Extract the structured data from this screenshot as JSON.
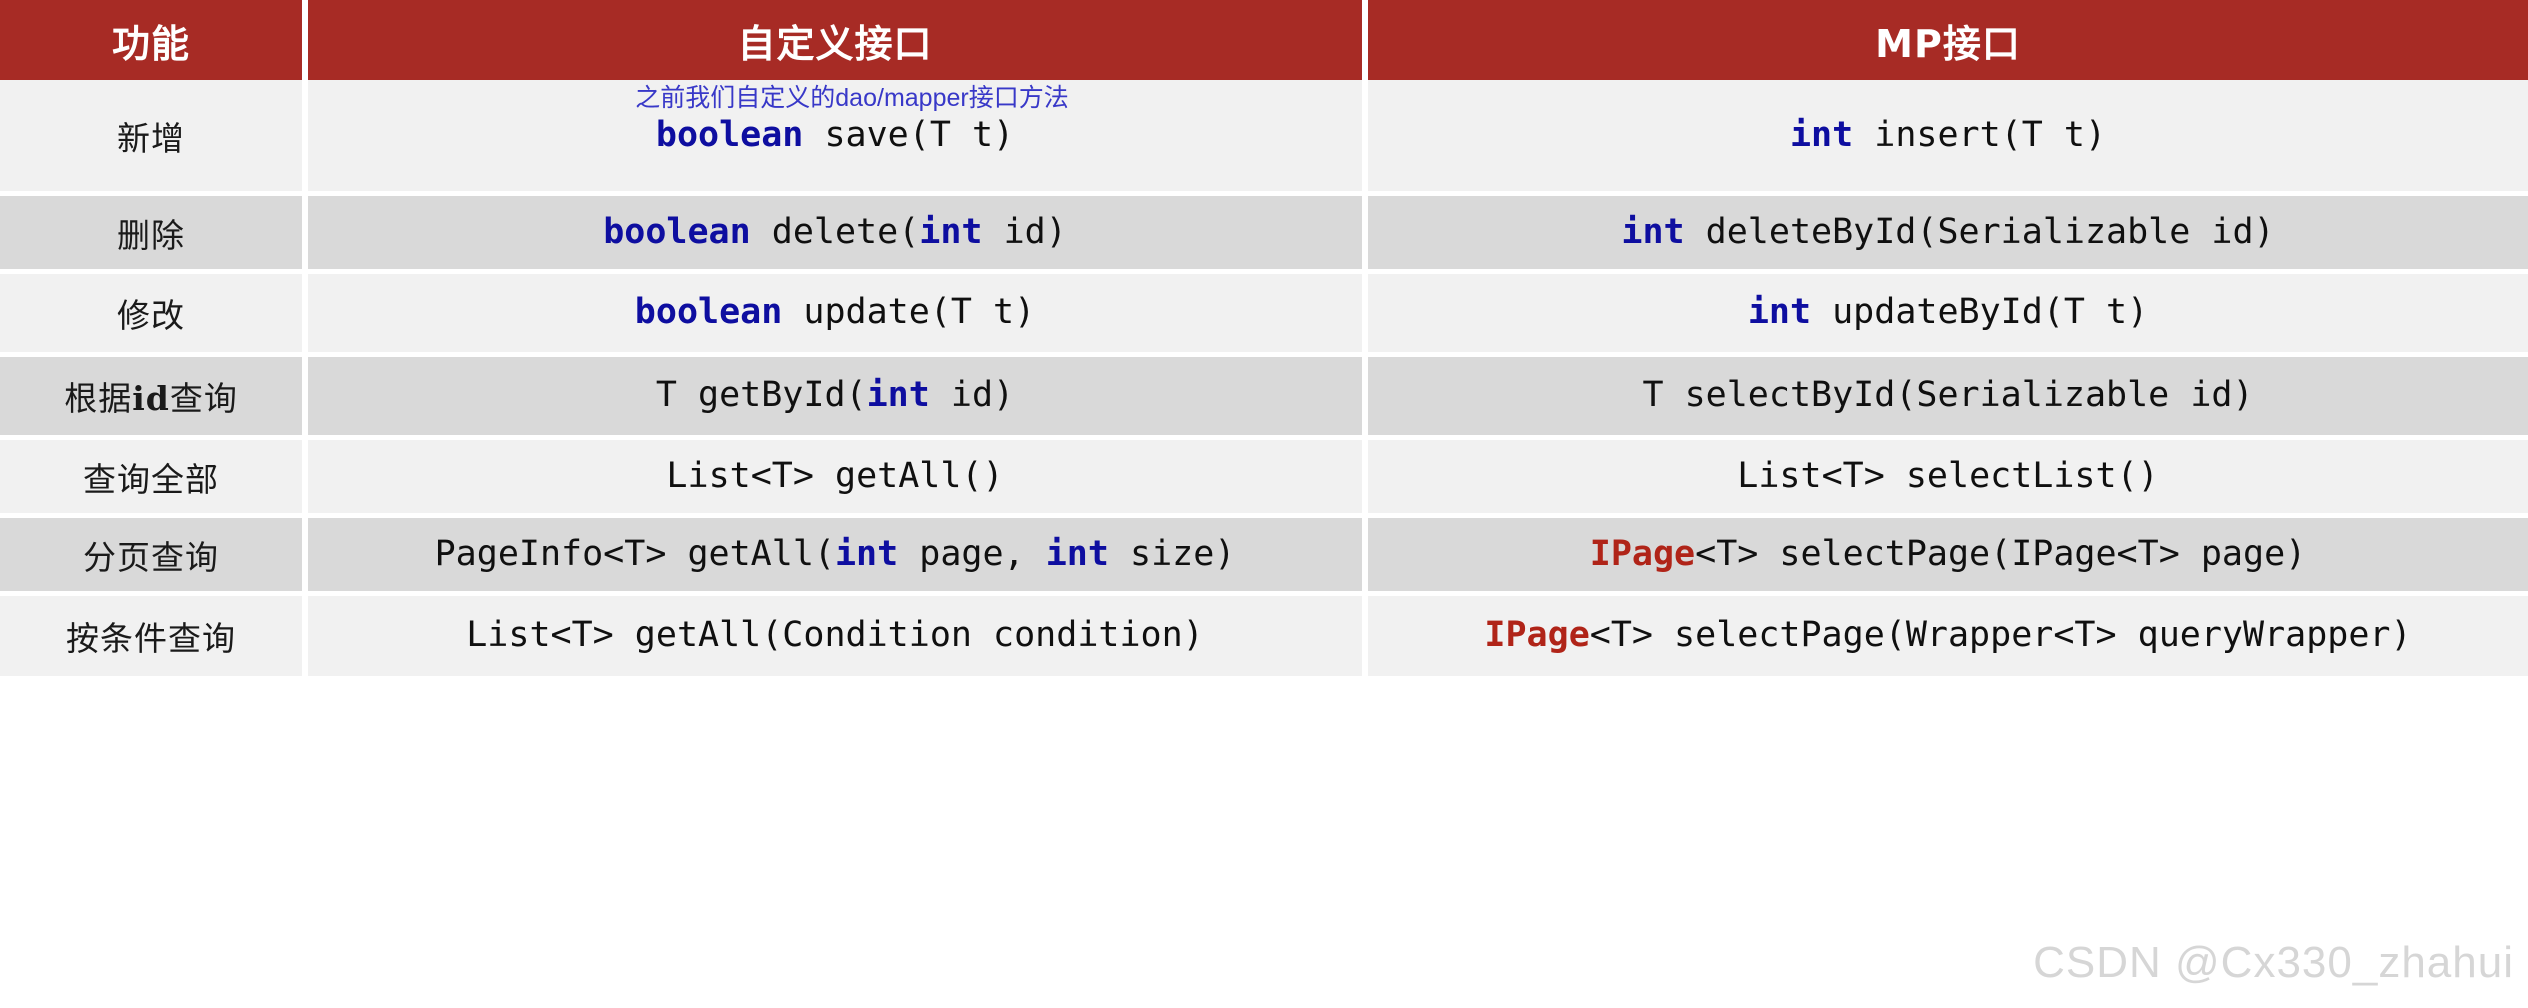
{
  "header": {
    "columns": [
      {
        "label": "功能",
        "key": "feature"
      },
      {
        "label": "自定义接口",
        "key": "custom"
      },
      {
        "label": "MP接口",
        "key": "mp"
      }
    ],
    "background_color": "#A72B25",
    "text_color": "#FFFFFF"
  },
  "annotation": {
    "text": "之前我们自定义的dao/mapper接口方法",
    "color": "#3838C8"
  },
  "colors": {
    "header_red": "#A72B25",
    "row_light": "#F1F1F1",
    "row_dark": "#D9D9D9",
    "keyword_blue": "#0E0EA0",
    "keyword_red": "#B02418",
    "watermark_gray": "#787878"
  },
  "rows": [
    {
      "feature": "新增",
      "feature_html": "新增",
      "custom_html": "<span class=\"kw\">boolean</span> save(T t)",
      "custom_text": "boolean save(T t)",
      "mp_html": "<span class=\"kw\">int</span> insert(T t)",
      "mp_text": "int insert(T t)"
    },
    {
      "feature": "删除",
      "feature_html": "删除",
      "custom_html": "<span class=\"kw\">boolean</span> delete(<span class=\"kw\">int</span> id)",
      "custom_text": "boolean delete(int id)",
      "mp_html": "<span class=\"kw\">int</span> deleteById(Serializable id)",
      "mp_text": "int deleteById(Serializable id)"
    },
    {
      "feature": "修改",
      "feature_html": "修改",
      "custom_html": "<span class=\"kw\">boolean</span> update(T t)",
      "custom_text": "boolean update(T t)",
      "mp_html": "<span class=\"kw\">int</span> updateById(T t)",
      "mp_text": "int updateById(T t)"
    },
    {
      "feature": "根据id查询",
      "feature_html": "根据<b>id</b>查询",
      "custom_html": "T getById(<span class=\"kw\">int</span> id)",
      "custom_text": "T getById(int id)",
      "mp_html": "T selectById(Serializable id)",
      "mp_text": "T selectById(Serializable id)"
    },
    {
      "feature": "查询全部",
      "feature_html": "查询全部",
      "custom_html": "List&lt;T&gt; getAll()",
      "custom_text": "List<T> getAll()",
      "mp_html": "List&lt;T&gt; selectList()",
      "mp_text": "List<T> selectList()"
    },
    {
      "feature": "分页查询",
      "feature_html": "分页查询",
      "custom_html": "PageInfo&lt;T&gt; getAll(<span class=\"kw\">int</span> page, <span class=\"kw\">int</span> size)",
      "custom_text": "PageInfo<T> getAll(int page, int size)",
      "mp_html": "<span class=\"kw-red\">IPage</span>&lt;T&gt; selectPage(IPage&lt;T&gt; page)",
      "mp_text": "IPage<T> selectPage(IPage<T> page)"
    },
    {
      "feature": "按条件查询",
      "feature_html": "按条件查询",
      "custom_html": "List&lt;T&gt; getAll(Condition condition)",
      "custom_text": "List<T> getAll(Condition condition)",
      "mp_html": "<span class=\"kw-red\">IPage</span>&lt;T&gt; selectPage(Wrapper&lt;T&gt; queryWrapper)",
      "mp_text": "IPage<T> selectPage(Wrapper<T> queryWrapper)"
    }
  ],
  "watermark": {
    "text": "CSDN @Cx330_zhahui"
  }
}
